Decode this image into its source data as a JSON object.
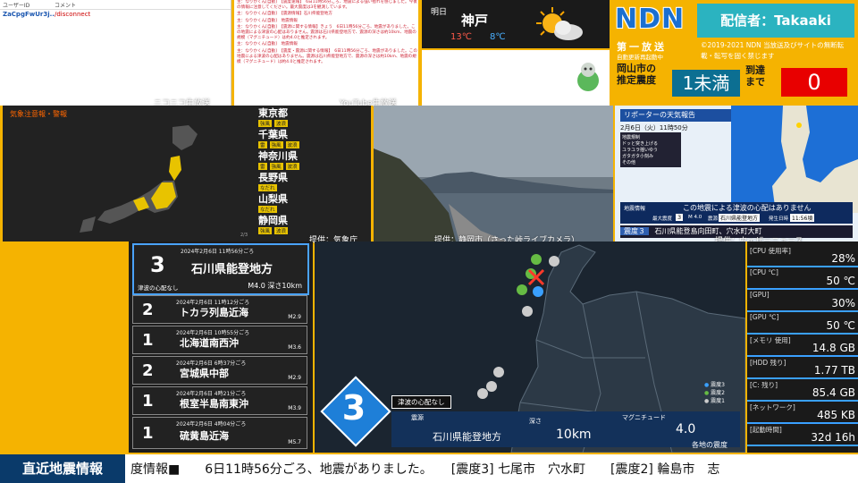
{
  "chat": {
    "col_user": "ユーザーID",
    "col_comment": "コメント",
    "user": "ZaCpgFwUr3j...",
    "comment": "/disconnect"
  },
  "log": [
    "主：なりかくん[自動]　【震度速報】　6日11時56分ごろ、地震による強い揺れを感じました。今後の情報に注意してください。最大震度は3を観測しています。",
    "主：なりかくん[自動]　【震源情報】石川県能登地方",
    "主：なりかくん[自動]　地震情報",
    "主：なりかくん[自動]　【震源に関する情報】きょう　6日11時56分ごろ、地震がありました。この地震による津波の心配はありません。震源は石川県能登地方で、震源の深さは約10km、地震の規模（マグニチュード）は約4.0と推定されます。",
    "主：なりかくん[自動]　地震情報",
    "主：なりかくん[自動]　【震度・震源に関する情報】　6日11時56分ごろ、地震がありました。この地震による津波の心配はありません。震源は石川県能登地方で、震源の深さは約10km、地震の規模（マグニチュード）は約4.0と推定されます。"
  ],
  "source_labels": {
    "niconico": "ニコニコ生放送",
    "youtube": "YouTube生放送"
  },
  "weather": {
    "label": "明日",
    "city": "神戸",
    "high": "13℃",
    "low": "8℃"
  },
  "ndn": {
    "logo": "NDN",
    "streamer": "配信者：Takaaki",
    "broadcast": "第一放送",
    "sub": "自動更新再起動中",
    "copyright": "©2019-2021 NDN 当放送及びサイトの無断転載・転写を固く禁じます",
    "est_label_1": "岡山市の",
    "est_label_2": "推定震度",
    "est_value": "1未満",
    "arrival_label_1": "到達",
    "arrival_label_2": "まで",
    "arrival_value": "0"
  },
  "warning": {
    "title": "気象注意報・警報",
    "prefs": [
      {
        "name": "東京都",
        "tags": [
          "強風",
          "波浪"
        ]
      },
      {
        "name": "千葉県",
        "tags": [
          "雷",
          "強風",
          "波浪"
        ]
      },
      {
        "name": "神奈川県",
        "tags": [
          "雷",
          "強風",
          "波浪"
        ]
      },
      {
        "name": "長野県",
        "tags": [
          "なだれ"
        ]
      },
      {
        "name": "山梨県",
        "tags": [
          "なだれ"
        ]
      },
      {
        "name": "静岡県",
        "tags": [
          "強風",
          "波浪"
        ]
      }
    ],
    "page": "2/3",
    "credit": "提供：気象庁"
  },
  "camera": {
    "credit": "提供：静岡市（さった峠ライブカメラ）"
  },
  "nhk": {
    "banner": "リポーターの天気報告",
    "time": "2月6日（火）11時50分",
    "legend_title": "地震規制",
    "legend": [
      "ドッと突き上げる",
      "ユラユラ揺いゆう",
      "ガタガタ小刻み",
      "その他"
    ],
    "info_label": "地震情報",
    "info_text": "この地震による津波の心配はありません",
    "max_label": "最大震度",
    "max_value": "3",
    "mag": "M 4.0",
    "epi_label": "震源",
    "epi_value": "石川県能登地方",
    "time_label": "発生日時",
    "time_value": "11:56頃",
    "bottom_int": "震度３",
    "bottom_place": "石川県能登島向田町、穴水町大町",
    "credit": "提供：ウェザーニュース"
  },
  "quakes": [
    {
      "date": "2024年2月6日 11時56分ごろ",
      "intensity": "3",
      "place": "石川県能登地方",
      "mag": "M4.0 深さ10km",
      "note": "津波の心配なし"
    },
    {
      "date": "2024年2月6日 11時12分ごろ",
      "intensity": "2",
      "place": "トカラ列島近海",
      "mag": "M2.9"
    },
    {
      "date": "2024年2月6日 10時55分ごろ",
      "intensity": "1",
      "place": "北海道南西沖",
      "mag": "M3.6"
    },
    {
      "date": "2024年2月6日 6時37分ごろ",
      "intensity": "2",
      "place": "宮城県中部",
      "mag": "M2.9"
    },
    {
      "date": "2024年2月6日 4時21分ごろ",
      "intensity": "1",
      "place": "根室半島南東沖",
      "mag": "M3.9"
    },
    {
      "date": "2024年2月6日 4時04分ごろ",
      "intensity": "1",
      "place": "硫黄島近海",
      "mag": "M5.7"
    }
  ],
  "map": {
    "big_int": "3",
    "tsunami": "津波の心配なし",
    "epi_label": "震源",
    "epi_value": "石川県能登地方",
    "depth_label": "深さ",
    "depth_value": "10km",
    "mag_label": "マグニチュード",
    "mag_value": "4.0",
    "legend": [
      "震度3",
      "震度2",
      "震度1"
    ],
    "caption": "各地の震度"
  },
  "stats": [
    {
      "label": "[CPU 使用率]",
      "value": "28%"
    },
    {
      "label": "[CPU ℃]",
      "value": "50 ℃"
    },
    {
      "label": "[GPU]",
      "value": "30%"
    },
    {
      "label": "[GPU ℃]",
      "value": "50 ℃"
    },
    {
      "label": "[メモリ 使用]",
      "value": "14.8 GB"
    },
    {
      "label": "[HDD 残り]",
      "value": "1.77 TB"
    },
    {
      "label": "[C: 残り]",
      "value": "85.4 GB"
    },
    {
      "label": "[ネットワーク]",
      "value": "485 KB"
    },
    {
      "label": "[起動時間]",
      "value": "32d 16h"
    }
  ],
  "ticker": {
    "label": "直近地震情報",
    "text": "度情報■　　6日11時56分ごろ、地震がありました。　　[震度3] 七尾市　穴水町　　[震度2] 輪島市　志"
  }
}
